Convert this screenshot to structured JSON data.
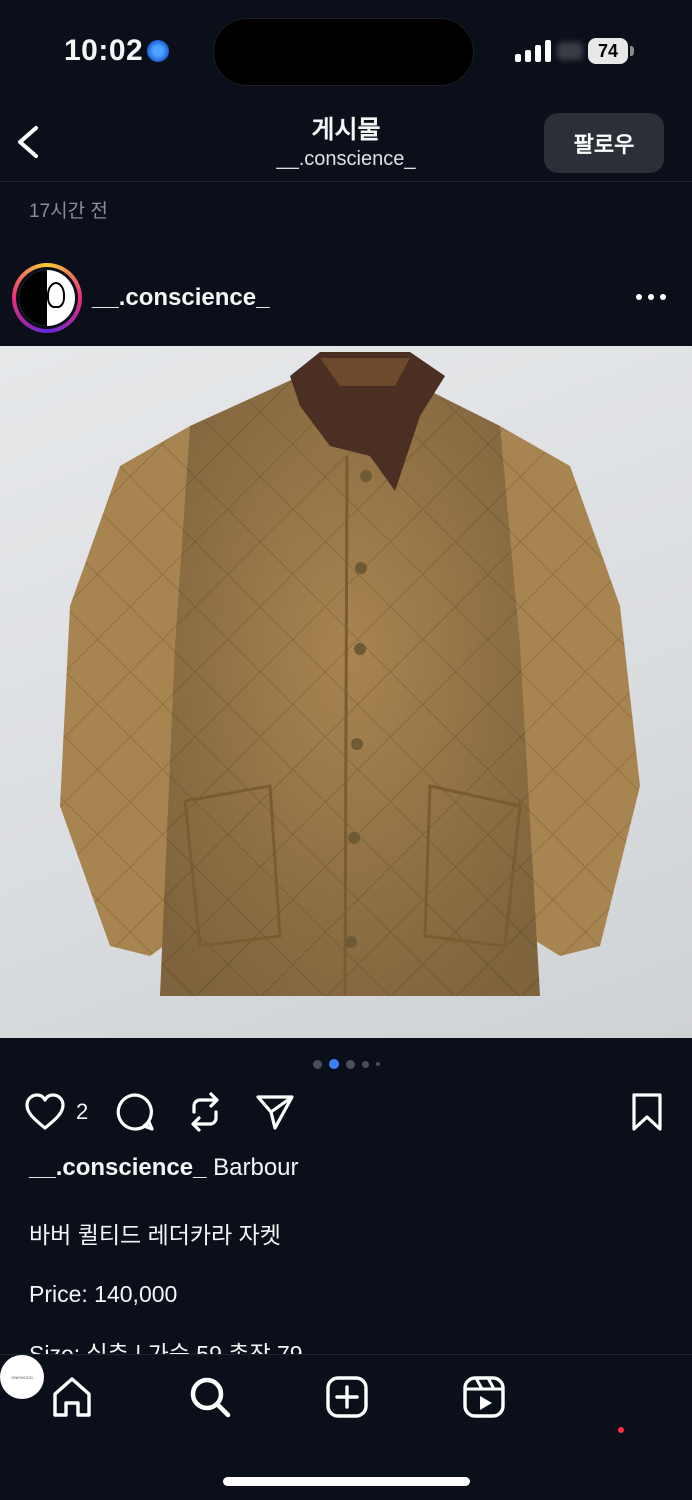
{
  "status_bar": {
    "time": "10:02",
    "battery": "74"
  },
  "header": {
    "title": "게시물",
    "subtitle": "__.conscience_",
    "follow_label": "팔로우"
  },
  "post": {
    "timestamp": "17시간 전",
    "username": "__.conscience_",
    "carousel": {
      "total_dots": 5,
      "active_index": 1
    },
    "like_count": "2",
    "caption": {
      "username": "__.conscience_",
      "brand": " Barbour",
      "title": "바버 퀼티드 레더카라 자켓",
      "price": "Price: 140,000",
      "size_partial": "Size: 실측 | 가슴 59 총장 79"
    }
  },
  "nav": {
    "profile_avatar_text": "ONEWOOD"
  },
  "colors": {
    "background": "#0b0f1a",
    "accent_blue": "#3b82f6",
    "notification_red": "#ff3040"
  }
}
